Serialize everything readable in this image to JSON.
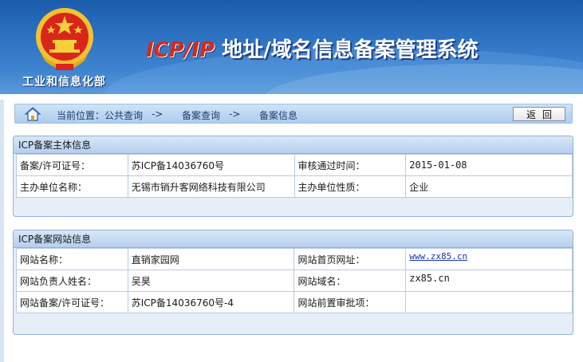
{
  "header": {
    "ministry_name": "工业和信息化部",
    "title_prefix": "ICP/IP",
    "title_main": "地址/域名信息备案管理系统"
  },
  "breadcrumb": {
    "home_icon": "home-icon",
    "items": [
      "当前位置：公共查询",
      "->",
      "备案查询",
      "->",
      "备案信息"
    ],
    "back_label": "返回"
  },
  "subject_panel": {
    "title": "ICP备案主体信息",
    "rows": [
      {
        "label1": "备案/许可证号：",
        "value1": "苏ICP备14036760号",
        "label2": "审核通过时间：",
        "value2": "2015-01-08"
      },
      {
        "label1": "主办单位名称：",
        "value1": "无锡市销升客网络科技有限公司",
        "label2": "主办单位性质：",
        "value2": "企业"
      }
    ]
  },
  "website_panel": {
    "title": "ICP备案网站信息",
    "rows": [
      {
        "label1": "网站名称：",
        "value1": "直销家园网",
        "label2": "网站首页网址：",
        "value2": "www.zx85.cn"
      },
      {
        "label1": "网站负责人姓名：",
        "value1": "吴昊",
        "label2": "网站域名：",
        "value2": "zx85.cn"
      },
      {
        "label1": "网站备案/许可证号：",
        "value1": "苏ICP备14036760号-4",
        "label2": "网站前置审批项：",
        "value2": ""
      }
    ]
  },
  "colors": {
    "header_blue": "#2e73c2",
    "title_red": "#d42a1e",
    "panel_border": "#8fb1dc",
    "link_blue": "#1a33a8"
  }
}
